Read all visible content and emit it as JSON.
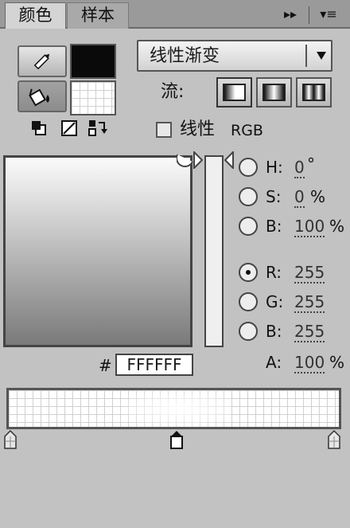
{
  "tabs": [
    {
      "label": "颜色",
      "active": true
    },
    {
      "label": "样本",
      "active": false
    }
  ],
  "panel_controls": {
    "collapse": "▸▸",
    "menu": "▾≡"
  },
  "fill_type": {
    "selected": "线性渐变"
  },
  "flow": {
    "label": "流:"
  },
  "linear_rgb": {
    "label": "线性",
    "suffix": "RGB",
    "checked": false
  },
  "hsb": {
    "h": {
      "label": "H:",
      "value": "0",
      "unit": "°"
    },
    "s": {
      "label": "S:",
      "value": "0",
      "unit": "%"
    },
    "b": {
      "label": "B:",
      "value": "100",
      "unit": "%"
    }
  },
  "rgb": {
    "selected": "R",
    "r": {
      "label": "R:",
      "value": "255"
    },
    "g": {
      "label": "G:",
      "value": "255"
    },
    "b": {
      "label": "B:",
      "value": "255"
    }
  },
  "alpha": {
    "label": "A:",
    "value": "100",
    "unit": "%"
  },
  "hex": {
    "label": "#",
    "value": "FFFFFF"
  },
  "colors": {
    "stroke": "#000000",
    "panel_bg": "#c2c2c2",
    "tabbar_bg": "#9a9a9a"
  }
}
